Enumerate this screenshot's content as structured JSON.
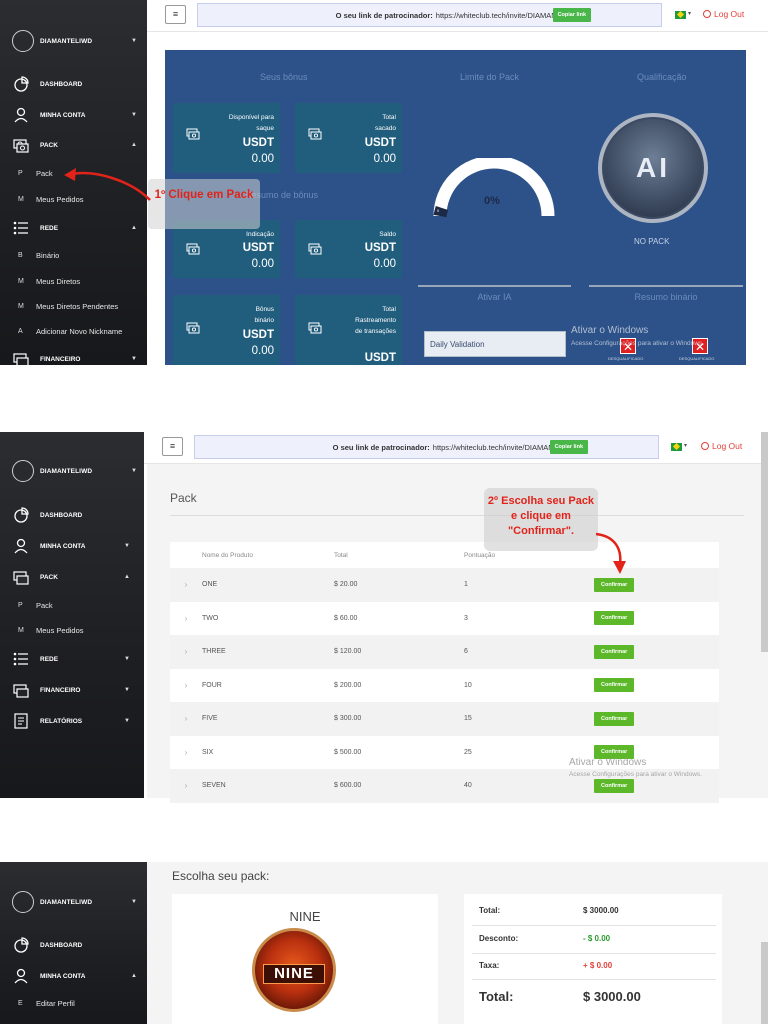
{
  "header": {
    "ref_label": "O seu link de patrocinador:",
    "ref_url": "https://whiteclub.tech/invite/DIAMANTELIWD",
    "copy_label": "Copiar link",
    "logout_label": "Log Out",
    "menu_glyph": "≡",
    "flag_caret": "▾"
  },
  "user": {
    "name": "DIAMANTELIWD"
  },
  "sidebar1": {
    "dashboard": "DASHBOARD",
    "minha_conta": "MINHA CONTA",
    "pack": "PACK",
    "sub_pack_ltr": "P",
    "sub_pack": "Pack",
    "sub_pedidos_ltr": "M",
    "sub_pedidos": "Meus Pedidos",
    "rede": "REDE",
    "sub_binario_ltr": "B",
    "sub_binario": "Binário",
    "sub_diretos_ltr": "M",
    "sub_diretos": "Meus Diretos",
    "sub_pendentes_ltr": "M",
    "sub_pendentes": "Meus Diretos Pendentes",
    "sub_nick_ltr": "A",
    "sub_nick": "Adicionar Novo Nickname",
    "financeiro": "FINANCEIRO"
  },
  "sidebar2": {
    "dashboard": "DASHBOARD",
    "minha_conta": "MINHA CONTA",
    "pack": "PACK",
    "sub_pack_ltr": "P",
    "sub_pack": "Pack",
    "sub_pedidos_ltr": "M",
    "sub_pedidos": "Meus Pedidos",
    "rede": "REDE",
    "financeiro": "FINANCEIRO",
    "relatorios": "RELATÓRIOS"
  },
  "sidebar3": {
    "dashboard": "DASHBOARD",
    "minha_conta": "MINHA CONTA",
    "sub_editar_ltr": "E",
    "sub_editar": "Editar Perfil"
  },
  "dashboard": {
    "seus_bonus": "Seus bônus",
    "limite_pack": "Limite do Pack",
    "qualificacao": "Qualificação",
    "resumo_bonus": "Resumo de bônus",
    "currency": "USDT",
    "kpis": [
      {
        "label": "Disponível para saque",
        "value": "0.00"
      },
      {
        "label": "Total sacado",
        "value": "0.00"
      },
      {
        "label": "Indicação",
        "value": "0.00"
      },
      {
        "label": "Saldo",
        "value": "0.00"
      },
      {
        "label": "Bônus binário",
        "value": "0.00"
      },
      {
        "label": "Total Rastreamento de transações",
        "value": ""
      }
    ],
    "gauge_pct": "0%",
    "gauge_value": 0,
    "gauge_min": "0",
    "gauge_max": "200",
    "ai_text": "AI",
    "no_pack": "NO PACK",
    "ativar_ia": "Ativar IA",
    "resumo_binario": "Resumo binário",
    "daily_validation": "Daily Validation",
    "desqualificado": "DESQUALIFICADO",
    "x_glyph": "✕",
    "colors": {
      "panel": "#2c5289",
      "kpi": "#215e7d"
    }
  },
  "callouts": {
    "one": "1º Clique em Pack",
    "two": "2º Escolha seu Pack e clique em \"Confirmar\"."
  },
  "pack_page": {
    "title": "Pack",
    "columns": [
      "Nome do Produto",
      "Total",
      "Pontuação",
      ""
    ],
    "confirm_label": "Confirmar",
    "chevron": "›",
    "rows": [
      {
        "name": "ONE",
        "total": "$ 20.00",
        "points": "1"
      },
      {
        "name": "TWO",
        "total": "$ 60.00",
        "points": "3"
      },
      {
        "name": "THREE",
        "total": "$ 120.00",
        "points": "6"
      },
      {
        "name": "FOUR",
        "total": "$ 200.00",
        "points": "10"
      },
      {
        "name": "FIVE",
        "total": "$ 300.00",
        "points": "15"
      },
      {
        "name": "SIX",
        "total": "$ 500.00",
        "points": "25"
      },
      {
        "name": "SEVEN",
        "total": "$ 600.00",
        "points": "40"
      }
    ]
  },
  "windows": {
    "title": "Ativar o Windows",
    "sub": "Acesse Configurações para ativar o Windows."
  },
  "checkout": {
    "heading": "Escolha seu pack:",
    "pack_name": "NINE",
    "badge_text": "NINE",
    "total_label": "Total:",
    "total_value": "$ 3000.00",
    "desconto_label": "Desconto:",
    "desconto_value": "- $ 0.00",
    "taxa_label": "Taxa:",
    "taxa_value": "+ $ 0.00",
    "grand_label": "Total:",
    "grand_value": "$ 3000.00",
    "colors": {
      "discount": "#2e9a2e",
      "tax": "#e0413a"
    }
  }
}
